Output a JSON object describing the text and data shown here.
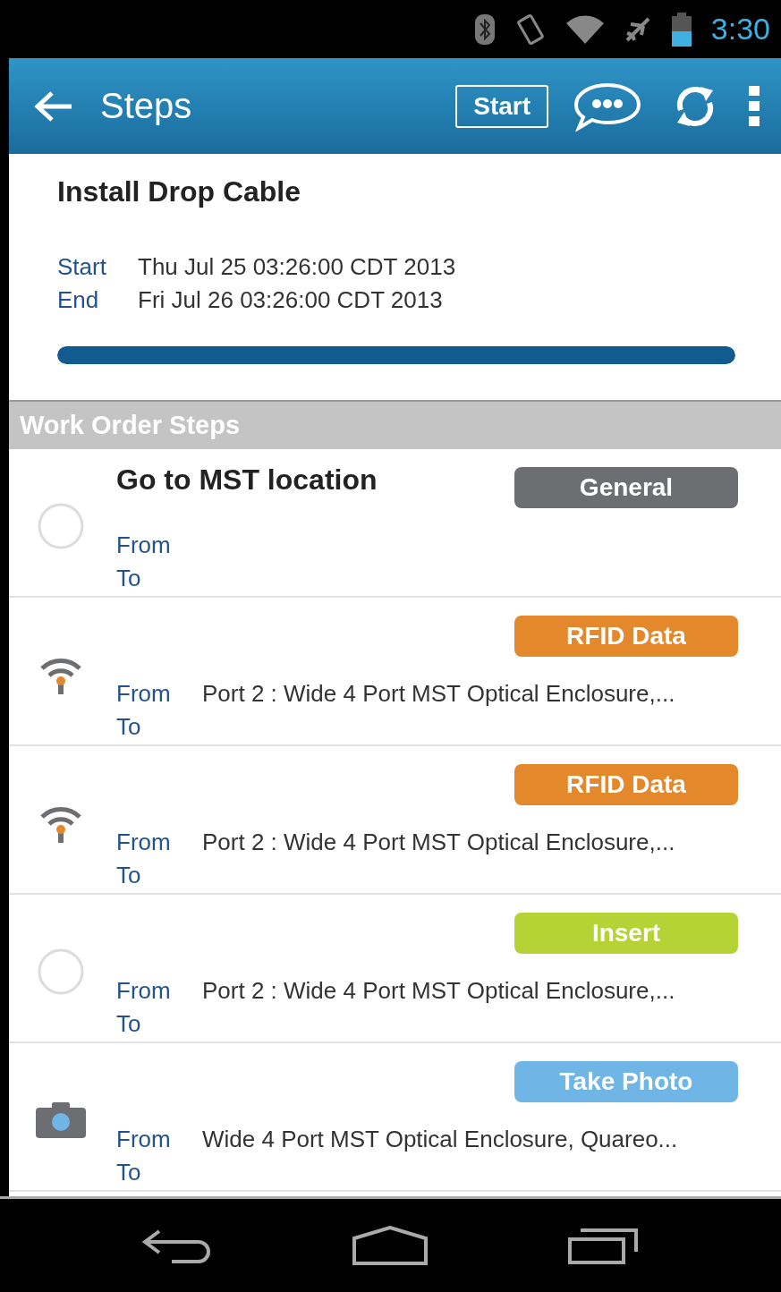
{
  "status_bar": {
    "time": "3:30"
  },
  "app_bar": {
    "title": "Steps",
    "start_button": "Start"
  },
  "job": {
    "title": "Install Drop Cable",
    "start_label": "Start",
    "start_value": "Thu Jul 25 03:26:00 CDT 2013",
    "end_label": "End",
    "end_value": "Fri Jul 26 03:26:00 CDT 2013",
    "progress": {
      "level": 1
    }
  },
  "section_title": "Work Order Steps",
  "steps": [
    {
      "kind": "circle",
      "title": "Go to MST location",
      "tag": "General",
      "color": "#6d6e71",
      "from_label": "From",
      "to_label": "To"
    },
    {
      "kind": "rfid",
      "tag": "RFID Data",
      "color": "#e4892b",
      "from_label": "From",
      "from_value": "Port 2 : Wide 4 Port MST Optical Enclosure,...",
      "to_label": "To"
    },
    {
      "kind": "rfid",
      "tag": "RFID Data",
      "color": "#e4892b",
      "from_label": "From",
      "from_value": "Port 2 : Wide 4 Port MST Optical Enclosure,...",
      "to_label": "To"
    },
    {
      "kind": "circle",
      "tag": "Insert",
      "color": "#b5d334",
      "from_label": "From",
      "from_value": "Port 2 : Wide 4 Port MST Optical Enclosure,...",
      "to_label": "To"
    },
    {
      "kind": "camera",
      "tag": "Take Photo",
      "color": "#6fb6e6",
      "from_label": "From",
      "from_value": "Wide 4 Port MST Optical Enclosure, Quareo...",
      "to_label": "To"
    }
  ]
}
